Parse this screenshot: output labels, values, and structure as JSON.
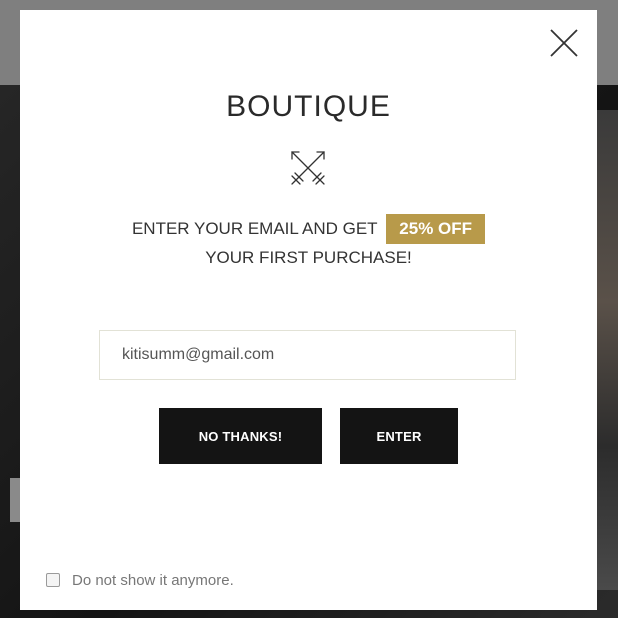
{
  "modal": {
    "brand": "BOUTIQUE",
    "offer": {
      "line1_text": "ENTER YOUR EMAIL AND GET",
      "badge": "25% OFF",
      "line2_text": "YOUR FIRST PURCHASE!"
    },
    "email_input": {
      "value": "kitisumm@gmail.com"
    },
    "buttons": {
      "no_thanks_label": "NO THANKS!",
      "enter_label": "ENTER"
    },
    "optout_label": "Do not show it anymore.",
    "icons": {
      "close": "close-icon",
      "brand_mark": "crossed-arrows-icon"
    },
    "colors": {
      "badge": "#b89a4a",
      "button": "#141414",
      "overlay": "#1f1f1f"
    }
  }
}
